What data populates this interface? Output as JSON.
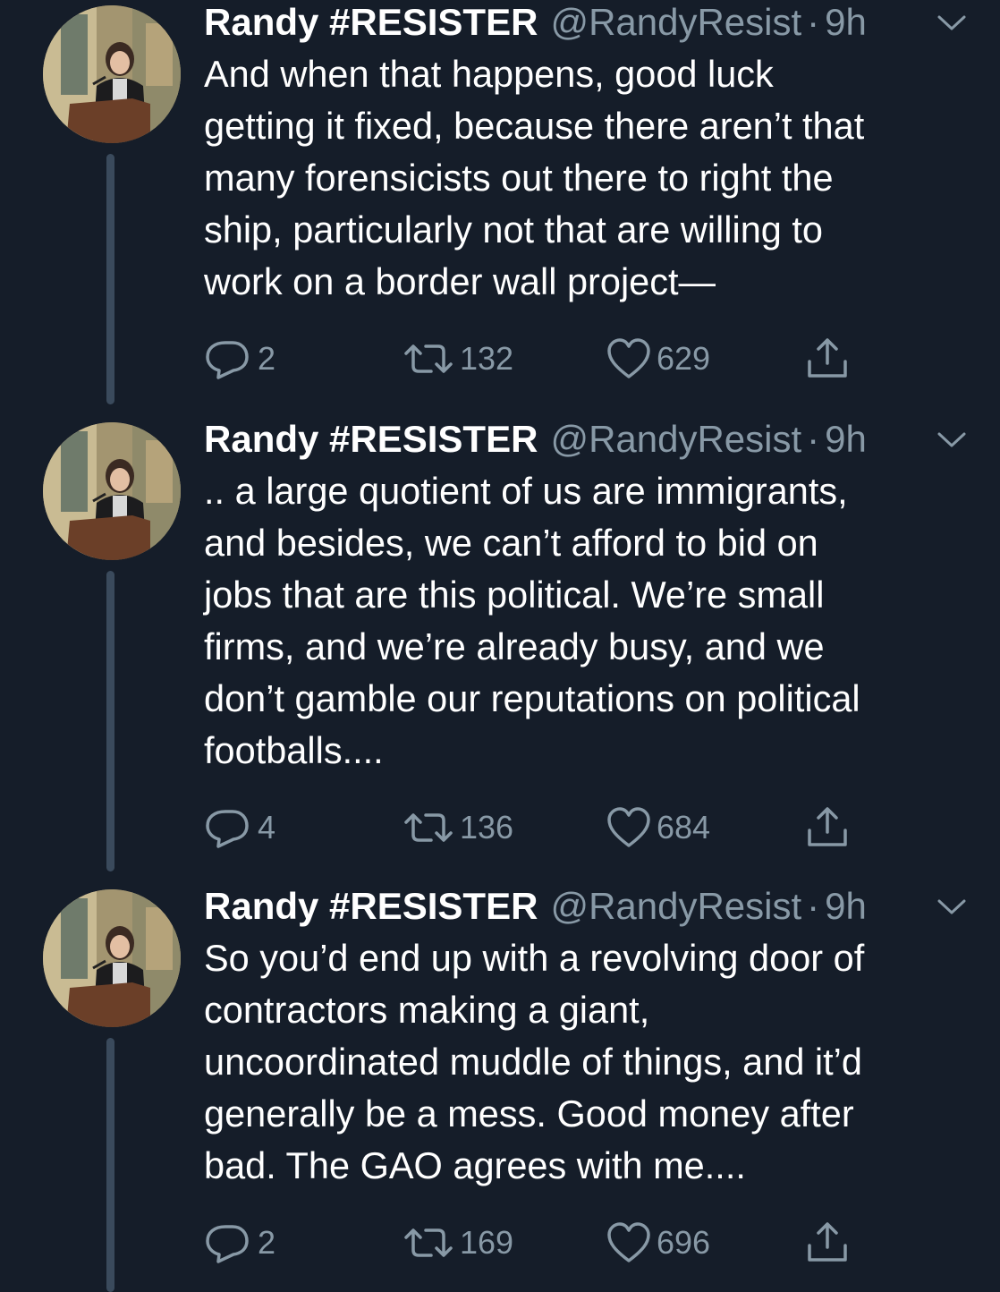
{
  "tweets": [
    {
      "name": "Randy #RESISTER",
      "handle": "@RandyResist",
      "separator": "·",
      "time": "9h",
      "lines": [
        "And when that happens, good luck",
        "getting it fixed, because there aren’t that",
        "many forensicists out there to right the",
        "ship, particularly not that are willing to",
        "work on a border wall project—"
      ],
      "replies": "2",
      "retweets": "132",
      "likes": "629"
    },
    {
      "name": "Randy #RESISTER",
      "handle": "@RandyResist",
      "separator": "·",
      "time": "9h",
      "lines": [
        ".. a large quotient of us are immigrants,",
        "and besides, we can’t afford to bid on",
        "jobs that are this political. We’re small",
        "firms, and we’re already busy, and we",
        "don’t gamble our reputations on political",
        "footballs...."
      ],
      "replies": "4",
      "retweets": "136",
      "likes": "684"
    },
    {
      "name": "Randy #RESISTER",
      "handle": "@RandyResist",
      "separator": "·",
      "time": "9h",
      "lines": [
        "So you’d end up with a revolving door of",
        "contractors making a giant,",
        "uncoordinated muddle of things, and it’d",
        "generally be a mess. Good money after",
        "bad. The GAO agrees with me...."
      ],
      "replies": "2",
      "retweets": "169",
      "likes": "696"
    }
  ],
  "icons": {
    "reply": "reply-icon",
    "retweet": "retweet-icon",
    "like": "heart-icon",
    "share": "share-icon",
    "menu": "chevron-down-icon"
  },
  "colors": {
    "background": "#151d29",
    "text": "#ffffff",
    "secondary": "#8899a6",
    "thread_line": "#3a4a5c"
  }
}
